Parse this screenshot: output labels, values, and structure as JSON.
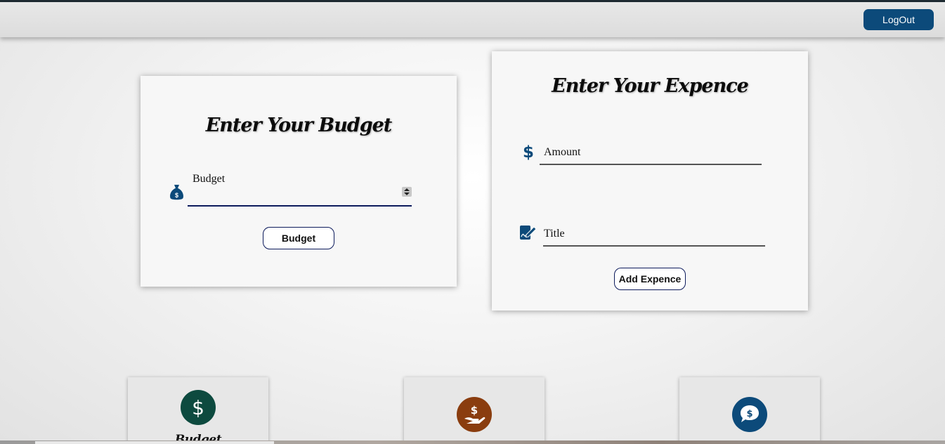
{
  "navbar": {
    "logout_label": "LogOut",
    "accent": "#0c4a7a"
  },
  "budget_card": {
    "title": "Enter Your Budget",
    "field_label": "Budget",
    "field_icon": "money-bag-icon",
    "button_label": "Budget"
  },
  "expense_card": {
    "title": "Enter Your Expence",
    "amount_label": "Amount",
    "amount_icon": "dollar-icon",
    "title_label": "Title",
    "title_icon": "edit-document-icon",
    "button_label": "Add Expence"
  },
  "summary_cards": [
    {
      "icon": "dollar-circle-icon",
      "color": "#0d4a3f",
      "label": "Budget"
    },
    {
      "icon": "hand-dollar-icon",
      "color": "#8a3d0f",
      "label": ""
    },
    {
      "icon": "dollar-speech-bubble-icon",
      "color": "#0c4a7a",
      "label": ""
    }
  ]
}
